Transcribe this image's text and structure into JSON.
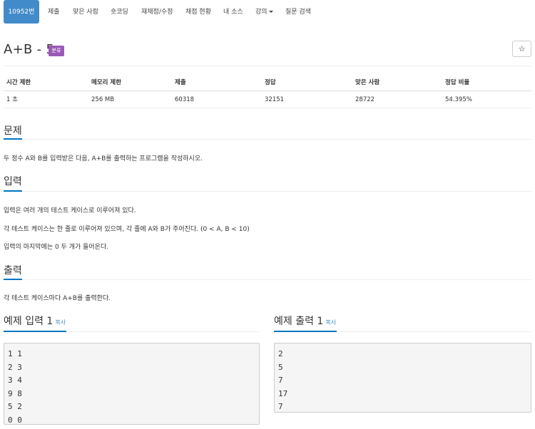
{
  "nav": {
    "items": [
      {
        "label": "10952번"
      },
      {
        "label": "제출"
      },
      {
        "label": "맞은 사람"
      },
      {
        "label": "숏코딩"
      },
      {
        "label": "재채점/수정"
      },
      {
        "label": "채점 현황"
      },
      {
        "label": "내 소스"
      },
      {
        "label": "강의"
      },
      {
        "label": "질문 검색"
      }
    ]
  },
  "problem": {
    "title": "A+B - 5",
    "category_badge": "분류",
    "star_icon": "☆"
  },
  "info": {
    "headers": [
      "시간 제한",
      "메모리 제한",
      "제출",
      "정답",
      "맞은 사람",
      "정답 비율"
    ],
    "values": [
      "1 초",
      "256 MB",
      "60318",
      "32151",
      "28722",
      "54.395%"
    ]
  },
  "sections": {
    "problem_head": "문제",
    "problem_body": "두 정수 A와 B를 입력받은 다음, A+B를 출력하는 프로그램을 작성하시오.",
    "input_head": "입력",
    "input_lines": [
      "입력은 여러 개의 테스트 케이스로 이루어져 있다.",
      "각 테스트 케이스는 한 줄로 이루어져 있으며, 각 줄에 A와 B가 주어진다. (0 < A, B < 10)",
      "입력의 마지막에는 0 두 개가 들어온다."
    ],
    "output_head": "출력",
    "output_body": "각 테스트 케이스마다 A+B를 출력한다."
  },
  "samples": {
    "input_head": "예제 입력 1",
    "output_head": "예제 출력 1",
    "copy_label": "복사",
    "input_lines": [
      "1 1",
      "2 3",
      "3 4",
      "9 8",
      "5 2",
      "0 0"
    ],
    "output_lines": [
      "2",
      "5",
      "7",
      "17",
      "7"
    ]
  },
  "colors": {
    "nav_active": "#428bca",
    "badge": "#9b59b6",
    "section_accent": "#0076c0",
    "link": "#428bca"
  }
}
